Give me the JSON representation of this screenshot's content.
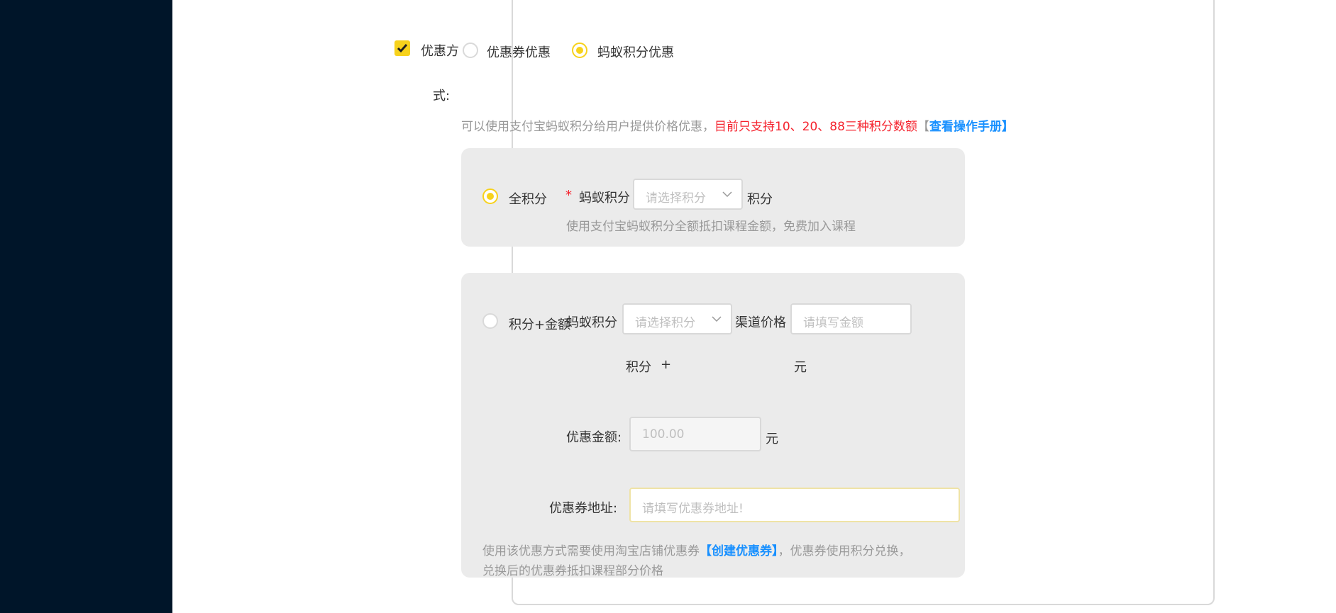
{
  "discount_method": {
    "label": "优惠方",
    "label_cont": "式:",
    "option_coupon": "优惠券优惠",
    "option_ant": "蚂蚁积分优惠"
  },
  "notice": {
    "text": "可以使用支付宝蚂蚁积分给用户提供价格优惠，",
    "red": "目前只支持10、20、88三种积分数额",
    "bracket_open": "【",
    "link": "查看操作手册",
    "bracket_close": "】"
  },
  "full_points": {
    "radio_label": "全积分",
    "required_mark": "*",
    "field_label": "蚂蚁积分",
    "select_placeholder": "请选择积分",
    "unit": "积分",
    "hint": "使用支付宝蚂蚁积分全额抵扣课程金额，免费加入课程"
  },
  "mixed": {
    "radio_label": "积分+金额",
    "field_label": "蚂蚁积分",
    "select_placeholder": "请选择积分",
    "price_label": "渠道价格",
    "price_placeholder": "请填写金额",
    "points_unit": "积分",
    "plus": "+",
    "yuan_unit": "元",
    "discount_label": "优惠金额:",
    "discount_value": "100.00",
    "discount_unit": "元",
    "coupon_url_label": "优惠券地址:",
    "coupon_url_placeholder": "请填写优惠券地址!",
    "footer_text_1": "使用该优惠方式需要使用淘宝店铺优惠券",
    "footer_bracket_open": "【",
    "footer_link": "创建优惠券",
    "footer_bracket_close": "】",
    "footer_text_2": "，优惠券使用积分兑换，",
    "footer_text_3": "兑换后的优惠券抵扣课程部分价格"
  },
  "colors": {
    "accent": "#f7d21c",
    "link": "#1890ff",
    "required": "#f5222d",
    "sidebar": "#001529"
  }
}
